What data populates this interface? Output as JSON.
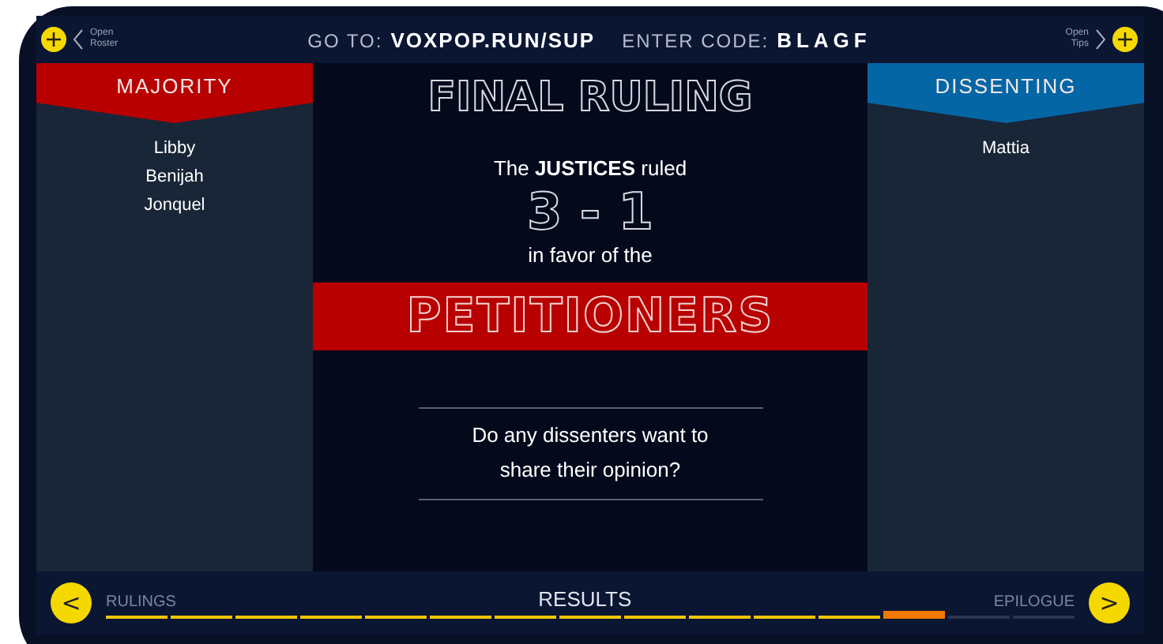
{
  "header": {
    "roster_link": [
      "Open",
      "Roster"
    ],
    "goto_label": "GO TO:",
    "goto_url": "VOXPOP.RUN/SUP",
    "code_label": "ENTER CODE:",
    "code": "BLAGF",
    "tips_link": [
      "Open",
      "Tips"
    ]
  },
  "majority": {
    "title": "MAJORITY",
    "names": [
      "Libby",
      "Benijah",
      "Jonquel"
    ]
  },
  "dissenting": {
    "title": "DISSENTING",
    "names": [
      "Mattia"
    ]
  },
  "center": {
    "title": "FINAL RULING",
    "intro": "The **JUSTICES** ruled",
    "score": "3 - 1",
    "favor": "in favor of the",
    "winner": "PETITIONERS",
    "question": "Do any dissenters want to share their opinion?"
  },
  "footer": {
    "prev_label": "RULINGS",
    "current_label": "RESULTS",
    "next_label": "EPILOGUE",
    "prev_button": "<",
    "next_button": ">",
    "segments": [
      {
        "selected": false
      },
      {
        "selected": false
      },
      {
        "selected": false
      },
      {
        "selected": false
      },
      {
        "selected": false
      },
      {
        "selected": false
      },
      {
        "selected": false
      },
      {
        "selected": false
      },
      {
        "selected": false
      },
      {
        "selected": false
      },
      {
        "selected": false
      },
      {
        "selected": false
      },
      {
        "selected": true
      },
      {
        "selected": false
      },
      {
        "selected": false
      }
    ]
  }
}
